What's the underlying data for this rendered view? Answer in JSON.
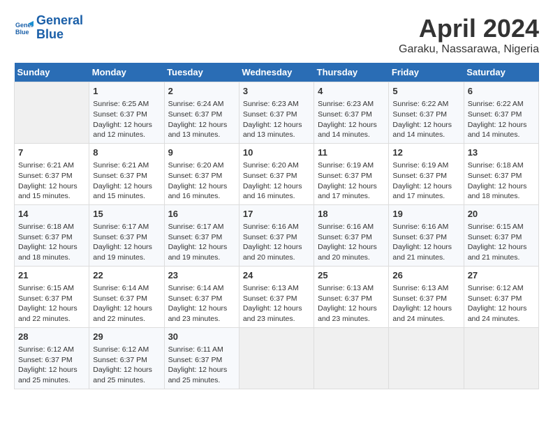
{
  "logo": {
    "line1": "General",
    "line2": "Blue"
  },
  "title": "April 2024",
  "subtitle": "Garaku, Nassarawa, Nigeria",
  "days_header": [
    "Sunday",
    "Monday",
    "Tuesday",
    "Wednesday",
    "Thursday",
    "Friday",
    "Saturday"
  ],
  "weeks": [
    [
      {
        "day": "",
        "content": ""
      },
      {
        "day": "1",
        "content": "Sunrise: 6:25 AM\nSunset: 6:37 PM\nDaylight: 12 hours\nand 12 minutes."
      },
      {
        "day": "2",
        "content": "Sunrise: 6:24 AM\nSunset: 6:37 PM\nDaylight: 12 hours\nand 13 minutes."
      },
      {
        "day": "3",
        "content": "Sunrise: 6:23 AM\nSunset: 6:37 PM\nDaylight: 12 hours\nand 13 minutes."
      },
      {
        "day": "4",
        "content": "Sunrise: 6:23 AM\nSunset: 6:37 PM\nDaylight: 12 hours\nand 14 minutes."
      },
      {
        "day": "5",
        "content": "Sunrise: 6:22 AM\nSunset: 6:37 PM\nDaylight: 12 hours\nand 14 minutes."
      },
      {
        "day": "6",
        "content": "Sunrise: 6:22 AM\nSunset: 6:37 PM\nDaylight: 12 hours\nand 14 minutes."
      }
    ],
    [
      {
        "day": "7",
        "content": "Sunrise: 6:21 AM\nSunset: 6:37 PM\nDaylight: 12 hours\nand 15 minutes."
      },
      {
        "day": "8",
        "content": "Sunrise: 6:21 AM\nSunset: 6:37 PM\nDaylight: 12 hours\nand 15 minutes."
      },
      {
        "day": "9",
        "content": "Sunrise: 6:20 AM\nSunset: 6:37 PM\nDaylight: 12 hours\nand 16 minutes."
      },
      {
        "day": "10",
        "content": "Sunrise: 6:20 AM\nSunset: 6:37 PM\nDaylight: 12 hours\nand 16 minutes."
      },
      {
        "day": "11",
        "content": "Sunrise: 6:19 AM\nSunset: 6:37 PM\nDaylight: 12 hours\nand 17 minutes."
      },
      {
        "day": "12",
        "content": "Sunrise: 6:19 AM\nSunset: 6:37 PM\nDaylight: 12 hours\nand 17 minutes."
      },
      {
        "day": "13",
        "content": "Sunrise: 6:18 AM\nSunset: 6:37 PM\nDaylight: 12 hours\nand 18 minutes."
      }
    ],
    [
      {
        "day": "14",
        "content": "Sunrise: 6:18 AM\nSunset: 6:37 PM\nDaylight: 12 hours\nand 18 minutes."
      },
      {
        "day": "15",
        "content": "Sunrise: 6:17 AM\nSunset: 6:37 PM\nDaylight: 12 hours\nand 19 minutes."
      },
      {
        "day": "16",
        "content": "Sunrise: 6:17 AM\nSunset: 6:37 PM\nDaylight: 12 hours\nand 19 minutes."
      },
      {
        "day": "17",
        "content": "Sunrise: 6:16 AM\nSunset: 6:37 PM\nDaylight: 12 hours\nand 20 minutes."
      },
      {
        "day": "18",
        "content": "Sunrise: 6:16 AM\nSunset: 6:37 PM\nDaylight: 12 hours\nand 20 minutes."
      },
      {
        "day": "19",
        "content": "Sunrise: 6:16 AM\nSunset: 6:37 PM\nDaylight: 12 hours\nand 21 minutes."
      },
      {
        "day": "20",
        "content": "Sunrise: 6:15 AM\nSunset: 6:37 PM\nDaylight: 12 hours\nand 21 minutes."
      }
    ],
    [
      {
        "day": "21",
        "content": "Sunrise: 6:15 AM\nSunset: 6:37 PM\nDaylight: 12 hours\nand 22 minutes."
      },
      {
        "day": "22",
        "content": "Sunrise: 6:14 AM\nSunset: 6:37 PM\nDaylight: 12 hours\nand 22 minutes."
      },
      {
        "day": "23",
        "content": "Sunrise: 6:14 AM\nSunset: 6:37 PM\nDaylight: 12 hours\nand 23 minutes."
      },
      {
        "day": "24",
        "content": "Sunrise: 6:13 AM\nSunset: 6:37 PM\nDaylight: 12 hours\nand 23 minutes."
      },
      {
        "day": "25",
        "content": "Sunrise: 6:13 AM\nSunset: 6:37 PM\nDaylight: 12 hours\nand 23 minutes."
      },
      {
        "day": "26",
        "content": "Sunrise: 6:13 AM\nSunset: 6:37 PM\nDaylight: 12 hours\nand 24 minutes."
      },
      {
        "day": "27",
        "content": "Sunrise: 6:12 AM\nSunset: 6:37 PM\nDaylight: 12 hours\nand 24 minutes."
      }
    ],
    [
      {
        "day": "28",
        "content": "Sunrise: 6:12 AM\nSunset: 6:37 PM\nDaylight: 12 hours\nand 25 minutes."
      },
      {
        "day": "29",
        "content": "Sunrise: 6:12 AM\nSunset: 6:37 PM\nDaylight: 12 hours\nand 25 minutes."
      },
      {
        "day": "30",
        "content": "Sunrise: 6:11 AM\nSunset: 6:37 PM\nDaylight: 12 hours\nand 25 minutes."
      },
      {
        "day": "",
        "content": ""
      },
      {
        "day": "",
        "content": ""
      },
      {
        "day": "",
        "content": ""
      },
      {
        "day": "",
        "content": ""
      }
    ]
  ]
}
